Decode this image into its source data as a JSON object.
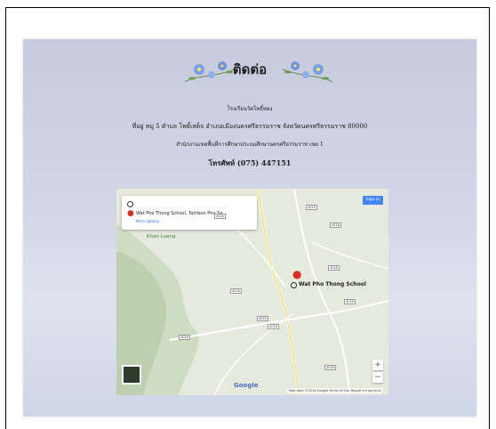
{
  "page": {
    "title": "ติดต่อ",
    "school_name": "โรงเรียนวัดโพธิ์ทอง",
    "address_line": "ที่อยู่ หมู่ 5 ตำบล โพธิ์เสด็จ อำเภอเมืองนครศรีธรรมราช จังหวัดนครศรีธรรมราช 80000",
    "office_line": "สำนักงานเขตพื้นที่การศึกษาประถมศึกษานครศรีธรรมราช เขต 1",
    "phone_line": "โทรศัพท์ (075) 447151"
  },
  "map": {
    "origin_placeholder": "",
    "destination": "Wat Pho Thong School, Tambon Pho Sa...",
    "more_options": "More options",
    "sign_in": "Sign in",
    "poi_label": "Khao Luang",
    "school_label": "Wat Pho Thong School",
    "google_logo": "Google",
    "attribution": "Map data ©2018 Google   Terms of Use   Report a map error",
    "zoom_in": "+",
    "zoom_out": "−",
    "road_labels": [
      "4016",
      "4015",
      "4016",
      "4016",
      "4016",
      "4016",
      "4016",
      "4016",
      "4016",
      "4016"
    ]
  },
  "colors": {
    "pin": "#d93025",
    "signin_bg": "#4285f4",
    "poi_green": "#3b8a3b"
  }
}
